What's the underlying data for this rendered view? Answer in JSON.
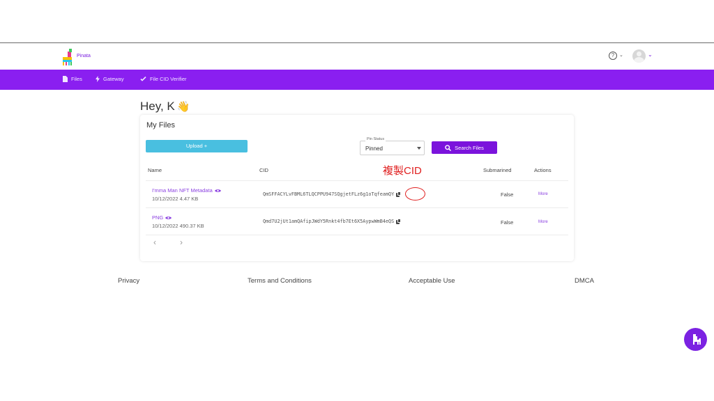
{
  "header": {
    "brand": "Pinata",
    "help_icon": "question-circle-icon",
    "avatar_icon": "user-avatar-icon"
  },
  "nav": {
    "items": [
      {
        "label": "Files",
        "icon": "file-icon"
      },
      {
        "label": "Gateway",
        "icon": "lightning-icon"
      },
      {
        "label": "File CID Verifier",
        "icon": "badge-check-icon"
      }
    ]
  },
  "greeting": "Hey, K",
  "greeting_emoji": "👋",
  "files": {
    "title": "My Files",
    "upload_label": "Upload +",
    "pin_status_label": "Pin Status",
    "pin_status_value": "Pinned",
    "search_label": "Search Files",
    "columns": [
      "Name",
      "CID",
      "Submarined",
      "Actions"
    ],
    "annotation": "複製CID",
    "rows": [
      {
        "name": "I'mma Man NFT Metadata",
        "meta": "10/12/2022 4.47 KB",
        "cid": "QmSFFACYLvFBML6TLQCPPU947SQgjetFLz6g1oTqfeamQY",
        "submarined": "False",
        "action": "More"
      },
      {
        "name": "PNG",
        "meta": "10/12/2022 490.37 KB",
        "cid": "Qmd7U2jUt1amQAfipJWdY5Rnkt4fb7Et6X5AypwWmB4eQS",
        "submarined": "False",
        "action": "More"
      }
    ],
    "pager": {
      "prev": "‹",
      "next": "›"
    }
  },
  "footer": {
    "links": [
      "Privacy",
      "Terms and Conditions",
      "Acceptable Use",
      "DMCA"
    ]
  },
  "colors": {
    "brand_purple": "#8a1ff0",
    "upload_blue": "#49bfe0",
    "annotation_red": "#e02020"
  }
}
